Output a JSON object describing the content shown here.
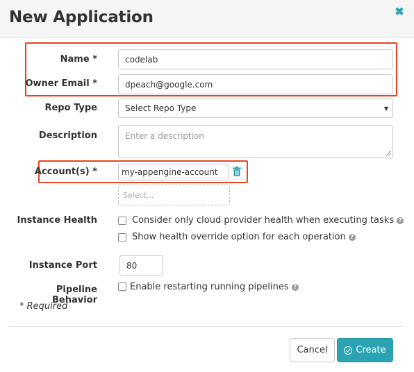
{
  "dialog": {
    "title": "New Application",
    "close_glyph": "✖"
  },
  "form": {
    "name": {
      "label": "Name *",
      "value": "codelab"
    },
    "owner_email": {
      "label": "Owner Email *",
      "value": "dpeach@google.com"
    },
    "repo_type": {
      "label": "Repo Type",
      "value": "Select Repo Type"
    },
    "description": {
      "label": "Description",
      "placeholder": "Enter a description"
    },
    "accounts": {
      "label": "Account(s) *",
      "selected": [
        "my-appengine-account"
      ],
      "placeholder": "Select..."
    },
    "instance_health": {
      "label": "Instance Health",
      "options": [
        {
          "label": "Consider only cloud provider health when executing tasks",
          "checked": false
        },
        {
          "label": "Show health override option for each operation",
          "checked": false
        }
      ]
    },
    "instance_port": {
      "label": "Instance Port",
      "value": "80"
    },
    "pipeline_behavior": {
      "label": "Pipeline Behavior",
      "options": [
        {
          "label": "Enable restarting running pipelines",
          "checked": false
        }
      ]
    },
    "required_note": "* Required"
  },
  "footer": {
    "cancel_label": "Cancel",
    "create_label": "Create"
  },
  "colors": {
    "accent": "#2aa3b3",
    "highlight": "#e7451f"
  }
}
